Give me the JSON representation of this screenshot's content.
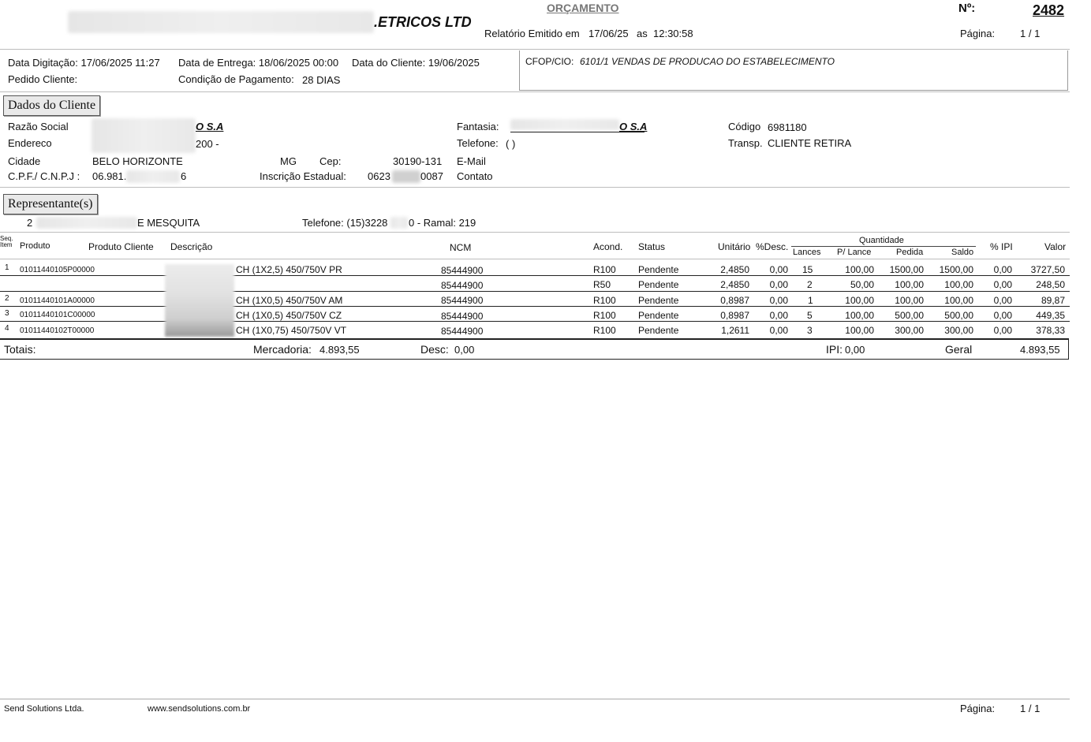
{
  "header": {
    "company_suffix": ".ETRICOS LTD",
    "doc_title": "ORÇAMENTO",
    "number_label": "Nº:",
    "number_value": "2482",
    "report_label": "Relatório Emitido em",
    "report_date": "17/06/25",
    "report_as": "as",
    "report_time": "12:30:58",
    "page_label": "Página:",
    "page_value": "1 / 1"
  },
  "order_info": {
    "data_digitacao": "Data Digitação: 17/06/2025 11:27",
    "data_entrega": "Data de Entrega: 18/06/2025 00:00",
    "data_cliente": "Data do Cliente: 19/06/2025",
    "pedido_cliente": "Pedido Cliente:",
    "condicao_label": "Condição de Pagamento:",
    "condicao_value": "28 DIAS",
    "cfop_label": "CFOP/CIO:",
    "cfop_value": "6101/1 VENDAS DE PRODUCAO DO ESTABELECIMENTO"
  },
  "cliente": {
    "section_title": "Dados do Cliente",
    "razao_label": "Razão Social",
    "razao_visible": "O S.A",
    "endereco_label": "Endereco",
    "endereco_visible": "200 -",
    "cidade_label": "Cidade",
    "cidade_value": "BELO HORIZONTE",
    "uf_value": "MG",
    "cep_label": "Cep:",
    "cep_value": "30190-131",
    "cnpj_label": "C.P.F./ C.N.P.J :",
    "cnpj_prefix": "06.981.",
    "cnpj_suffix": "6",
    "ie_label": "Inscrição Estadual:",
    "ie_prefix": "0623",
    "ie_suffix": "0087",
    "fantasia_label": "Fantasia:",
    "fantasia_visible": "O S.A",
    "telefone_label": "Telefone:",
    "telefone_value": "(          )",
    "email_label": "E-Mail",
    "contato_label": "Contato",
    "codigo_label": "Código",
    "codigo_value": "6981180",
    "transp_label": "Transp.",
    "transp_value": "CLIENTE RETIRA"
  },
  "representante": {
    "section_title": "Representante(s)",
    "code": "2",
    "name_visible": "E MESQUITA",
    "telefone_prefix": "Telefone: (15)3228",
    "telefone_suffix": "0 - Ramal: 219"
  },
  "table": {
    "headers": {
      "seq": "Seq. Item",
      "produto": "Produto",
      "produto_cliente": "Produto Cliente",
      "descricao": "Descrição",
      "ncm": "NCM",
      "acond": "Acond.",
      "status": "Status",
      "unitario": "Unitário",
      "desc": "%Desc.",
      "quantidade": "Quantidade",
      "lances": "Lances",
      "p_lance": "P/ Lance",
      "pedida": "Pedida",
      "saldo": "Saldo",
      "ipi": "% IPI",
      "valor": "Valor"
    },
    "rows": [
      {
        "seq": "1",
        "produto": "01011440105P00000",
        "descricao": "CH (1X2,5) 450/750V PR",
        "ncm": "85444900",
        "acond": "R100",
        "status": "Pendente",
        "unitario": "2,4850",
        "desc": "0,00",
        "lances": "15",
        "p_lance": "100,00",
        "pedida": "1500,00",
        "saldo": "1500,00",
        "ipi": "0,00",
        "valor": "3727,50"
      },
      {
        "seq": "",
        "produto": "",
        "descricao": "",
        "ncm": "85444900",
        "acond": "R50",
        "status": "Pendente",
        "unitario": "2,4850",
        "desc": "0,00",
        "lances": "2",
        "p_lance": "50,00",
        "pedida": "100,00",
        "saldo": "100,00",
        "ipi": "0,00",
        "valor": "248,50"
      },
      {
        "seq": "2",
        "produto": "01011440101A00000",
        "descricao": "CH (1X0,5) 450/750V AM",
        "ncm": "85444900",
        "acond": "R100",
        "status": "Pendente",
        "unitario": "0,8987",
        "desc": "0,00",
        "lances": "1",
        "p_lance": "100,00",
        "pedida": "100,00",
        "saldo": "100,00",
        "ipi": "0,00",
        "valor": "89,87"
      },
      {
        "seq": "3",
        "produto": "01011440101C00000",
        "descricao": "CH (1X0,5) 450/750V CZ",
        "ncm": "85444900",
        "acond": "R100",
        "status": "Pendente",
        "unitario": "0,8987",
        "desc": "0,00",
        "lances": "5",
        "p_lance": "100,00",
        "pedida": "500,00",
        "saldo": "500,00",
        "ipi": "0,00",
        "valor": "449,35"
      },
      {
        "seq": "4",
        "produto": "01011440102T00000",
        "descricao": "CH (1X0,75) 450/750V VT",
        "ncm": "85444900",
        "acond": "R100",
        "status": "Pendente",
        "unitario": "1,2611",
        "desc": "0,00",
        "lances": "3",
        "p_lance": "100,00",
        "pedida": "300,00",
        "saldo": "300,00",
        "ipi": "0,00",
        "valor": "378,33"
      }
    ]
  },
  "totals": {
    "label": "Totais:",
    "mercadoria_label": "Mercadoria:",
    "mercadoria_value": "4.893,55",
    "desc_label": "Desc:",
    "desc_value": "0,00",
    "ipi_label": "IPI:",
    "ipi_value": "0,00",
    "geral_label": "Geral",
    "geral_value": "4.893,55"
  },
  "footer": {
    "company": "Send Solutions Ltda.",
    "site": "www.sendsolutions.com.br",
    "page_label": "Página:",
    "page_value": "1 / 1"
  }
}
